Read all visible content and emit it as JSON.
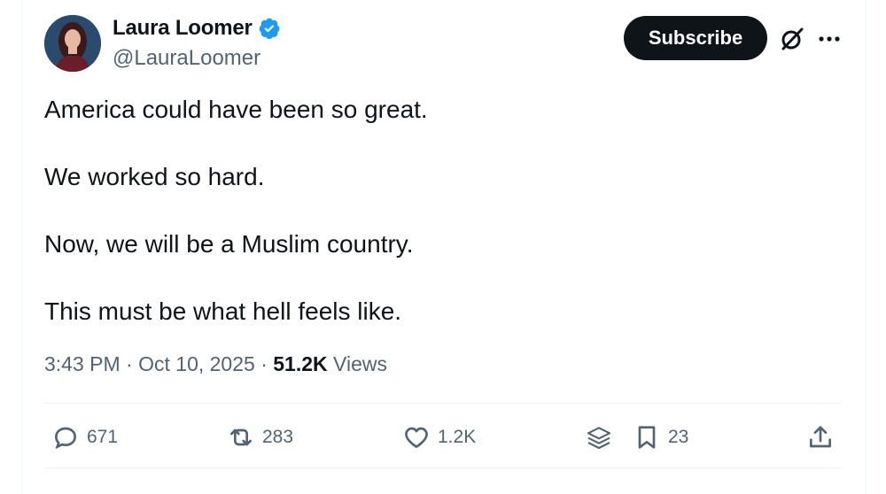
{
  "author": {
    "name": "Laura Loomer",
    "handle": "@LauraLoomer",
    "verified": true
  },
  "header": {
    "subscribe_label": "Subscribe",
    "icons": [
      "grok-icon",
      "more-icon"
    ]
  },
  "tweet": {
    "lines": [
      "America could have been so great.",
      "We worked so hard.",
      "Now, we will be a Muslim country.",
      "This must be what hell feels like."
    ]
  },
  "meta": {
    "time": "3:43 PM",
    "sep1": " · ",
    "date": "Oct 10, 2025",
    "sep2": " · ",
    "views_count": "51.2K",
    "views_label": " Views"
  },
  "actions": {
    "replies": "671",
    "reposts": "283",
    "likes": "1.2K",
    "bookmarks": "23"
  },
  "colors": {
    "text": "#0f1419",
    "secondary": "#536471",
    "verified": "#1d9bf0",
    "button": "#0f1419"
  }
}
